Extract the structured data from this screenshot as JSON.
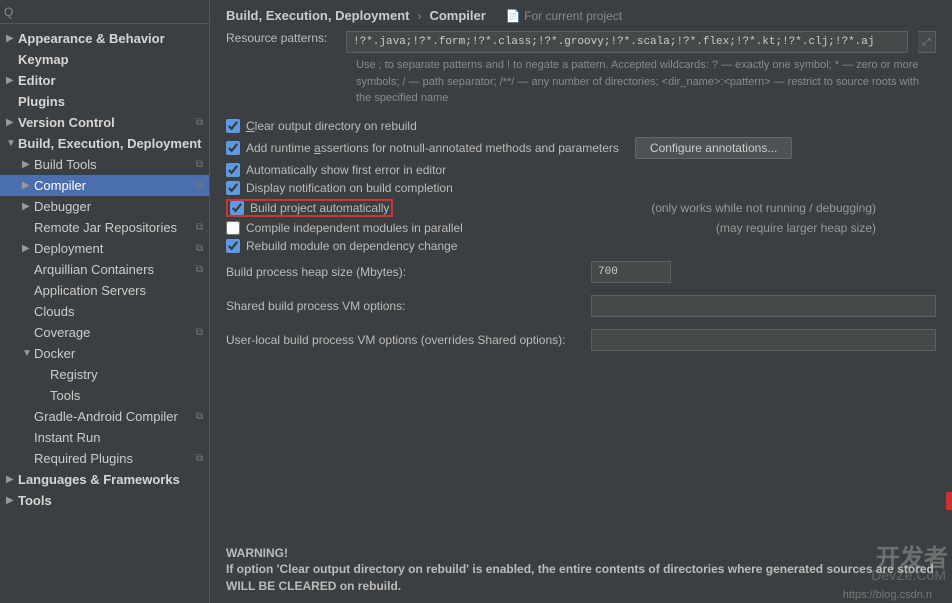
{
  "search": {
    "placeholder": ""
  },
  "sidebar": {
    "items": [
      {
        "label": "Appearance & Behavior",
        "bold": true,
        "arrow": "▶",
        "depth": 0
      },
      {
        "label": "Keymap",
        "bold": true,
        "depth": 0,
        "indent": true
      },
      {
        "label": "Editor",
        "bold": true,
        "arrow": "▶",
        "depth": 0
      },
      {
        "label": "Plugins",
        "bold": true,
        "depth": 0,
        "indent": true
      },
      {
        "label": "Version Control",
        "bold": true,
        "arrow": "▶",
        "depth": 0,
        "badge": true
      },
      {
        "label": "Build, Execution, Deployment",
        "bold": true,
        "arrow": "▼",
        "depth": 0
      },
      {
        "label": "Build Tools",
        "arrow": "▶",
        "depth": 1,
        "badge": true
      },
      {
        "label": "Compiler",
        "arrow": "▶",
        "depth": 1,
        "badge": true,
        "selected": true
      },
      {
        "label": "Debugger",
        "arrow": "▶",
        "depth": 1
      },
      {
        "label": "Remote Jar Repositories",
        "depth": 1,
        "indent": true,
        "badge": true
      },
      {
        "label": "Deployment",
        "arrow": "▶",
        "depth": 1,
        "badge": true
      },
      {
        "label": "Arquillian Containers",
        "depth": 1,
        "indent": true,
        "badge": true
      },
      {
        "label": "Application Servers",
        "depth": 1,
        "indent": true
      },
      {
        "label": "Clouds",
        "depth": 1,
        "indent": true
      },
      {
        "label": "Coverage",
        "depth": 1,
        "indent": true,
        "badge": true
      },
      {
        "label": "Docker",
        "arrow": "▼",
        "depth": 1
      },
      {
        "label": "Registry",
        "depth": 2,
        "indent": true
      },
      {
        "label": "Tools",
        "depth": 2,
        "indent": true
      },
      {
        "label": "Gradle-Android Compiler",
        "depth": 1,
        "indent": true,
        "badge": true
      },
      {
        "label": "Instant Run",
        "depth": 1,
        "indent": true
      },
      {
        "label": "Required Plugins",
        "depth": 1,
        "indent": true,
        "badge": true
      },
      {
        "label": "Languages & Frameworks",
        "bold": true,
        "arrow": "▶",
        "depth": 0
      },
      {
        "label": "Tools",
        "bold": true,
        "arrow": "▶",
        "depth": 0
      }
    ]
  },
  "breadcrumb": {
    "a": "Build, Execution, Deployment",
    "b": "Compiler",
    "scope": "For current project",
    "scope_icon": "📄"
  },
  "resource": {
    "label": "Resource patterns:",
    "value": "!?*.java;!?*.form;!?*.class;!?*.groovy;!?*.scala;!?*.flex;!?*.kt;!?*.clj;!?*.aj",
    "help": "Use ; to separate patterns and ! to negate a pattern. Accepted wildcards: ? — exactly one symbol; * — zero or more symbols; / — path separator; /**/ — any number of directories; <dir_name>:<pattern> — restrict to source roots with the specified name"
  },
  "checks": {
    "clear": {
      "label": "Clear output directory on rebuild",
      "u": "C",
      "checked": true
    },
    "asserts": {
      "label": "Add runtime assertions for notnull-annotated methods and parameters",
      "u": "a",
      "checked": true
    },
    "config_btn": "Configure annotations...",
    "autoshow": {
      "label": "Automatically show first error in editor",
      "checked": true
    },
    "notify": {
      "label": "Display notification on build completion",
      "checked": true
    },
    "autobuild": {
      "label": "Build project automatically",
      "checked": true,
      "note": "(only works while not running / debugging)"
    },
    "parallel": {
      "label": "Compile independent modules in parallel",
      "checked": false,
      "note": "(may require larger heap size)"
    },
    "rebuild_dep": {
      "label": "Rebuild module on dependency change",
      "checked": true
    }
  },
  "heap": {
    "label": "Build process heap size (Mbytes):",
    "value": "700"
  },
  "shared_vm": {
    "label": "Shared build process VM options:",
    "value": ""
  },
  "user_vm": {
    "label": "User-local build process VM options (overrides Shared options):",
    "value": ""
  },
  "warning": {
    "title": "WARNING!",
    "text": "If option 'Clear output directory on rebuild' is enabled, the entire contents of directories where generated sources are stored WILL BE CLEARED on rebuild."
  },
  "watermark": {
    "top": "开发者",
    "sub": "DevZe.CoM"
  },
  "blog": "https://blog.csdn.n"
}
